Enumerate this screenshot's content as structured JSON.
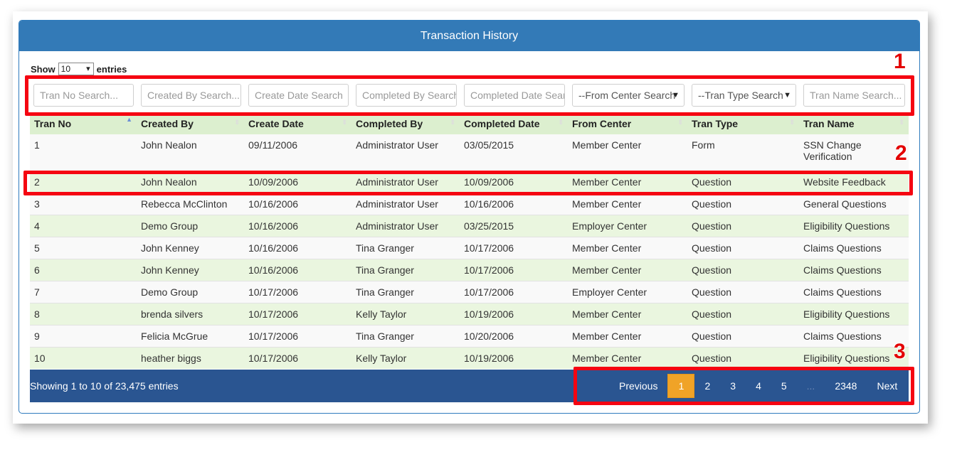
{
  "panel": {
    "title": "Transaction History"
  },
  "length": {
    "show_label": "Show",
    "value": "10",
    "entries_label": "entries"
  },
  "filters": [
    {
      "placeholder": "Tran No Search..."
    },
    {
      "placeholder": "Created By Search..."
    },
    {
      "placeholder": "Create Date Search"
    },
    {
      "placeholder": "Completed By Search"
    },
    {
      "placeholder": "Completed Date Search"
    },
    {
      "value": "--From Center Search"
    },
    {
      "value": "--Tran Type Search"
    },
    {
      "placeholder": "Tran Name Search..."
    }
  ],
  "table": {
    "headers": [
      "Tran No",
      "Created By",
      "Create Date",
      "Completed By",
      "Completed Date",
      "From Center",
      "Tran Type",
      "Tran Name"
    ],
    "rows": [
      [
        "1",
        "John Nealon",
        "09/11/2006",
        "Administrator User",
        "03/05/2015",
        "Member Center",
        "Form",
        "SSN Change Verification"
      ],
      [
        "2",
        "John Nealon",
        "10/09/2006",
        "Administrator User",
        "10/09/2006",
        "Member Center",
        "Question",
        "Website Feedback"
      ],
      [
        "3",
        "Rebecca McClinton",
        "10/16/2006",
        "Administrator User",
        "10/16/2006",
        "Member Center",
        "Question",
        "General Questions"
      ],
      [
        "4",
        "Demo Group",
        "10/16/2006",
        "Administrator User",
        "03/25/2015",
        "Employer Center",
        "Question",
        "Eligibility Questions"
      ],
      [
        "5",
        "John Kenney",
        "10/16/2006",
        "Tina Granger",
        "10/17/2006",
        "Member Center",
        "Question",
        "Claims Questions"
      ],
      [
        "6",
        "John Kenney",
        "10/16/2006",
        "Tina Granger",
        "10/17/2006",
        "Member Center",
        "Question",
        "Claims Questions"
      ],
      [
        "7",
        "Demo Group",
        "10/17/2006",
        "Tina Granger",
        "10/17/2006",
        "Employer Center",
        "Question",
        "Claims Questions"
      ],
      [
        "8",
        "brenda silvers",
        "10/17/2006",
        "Kelly Taylor",
        "10/19/2006",
        "Member Center",
        "Question",
        "Eligibility Questions"
      ],
      [
        "9",
        "Felicia McGrue",
        "10/17/2006",
        "Tina Granger",
        "10/20/2006",
        "Member Center",
        "Question",
        "Claims Questions"
      ],
      [
        "10",
        "heather biggs",
        "10/17/2006",
        "Kelly Taylor",
        "10/19/2006",
        "Member Center",
        "Question",
        "Eligibility Questions"
      ]
    ]
  },
  "footer": {
    "info": "Showing 1 to 10 of 23,475 entries",
    "pager": {
      "previous": "Previous",
      "pages": [
        "1",
        "2",
        "3",
        "4",
        "5"
      ],
      "ellipsis": "...",
      "last": "2348",
      "next": "Next",
      "active": "1"
    }
  },
  "annotations": {
    "n1": "1",
    "n2": "2",
    "n3": "3"
  },
  "colors": {
    "header": "#337ab7",
    "footer": "#2a5591",
    "accent_active": "#f0a327",
    "callout": "#f50511"
  }
}
